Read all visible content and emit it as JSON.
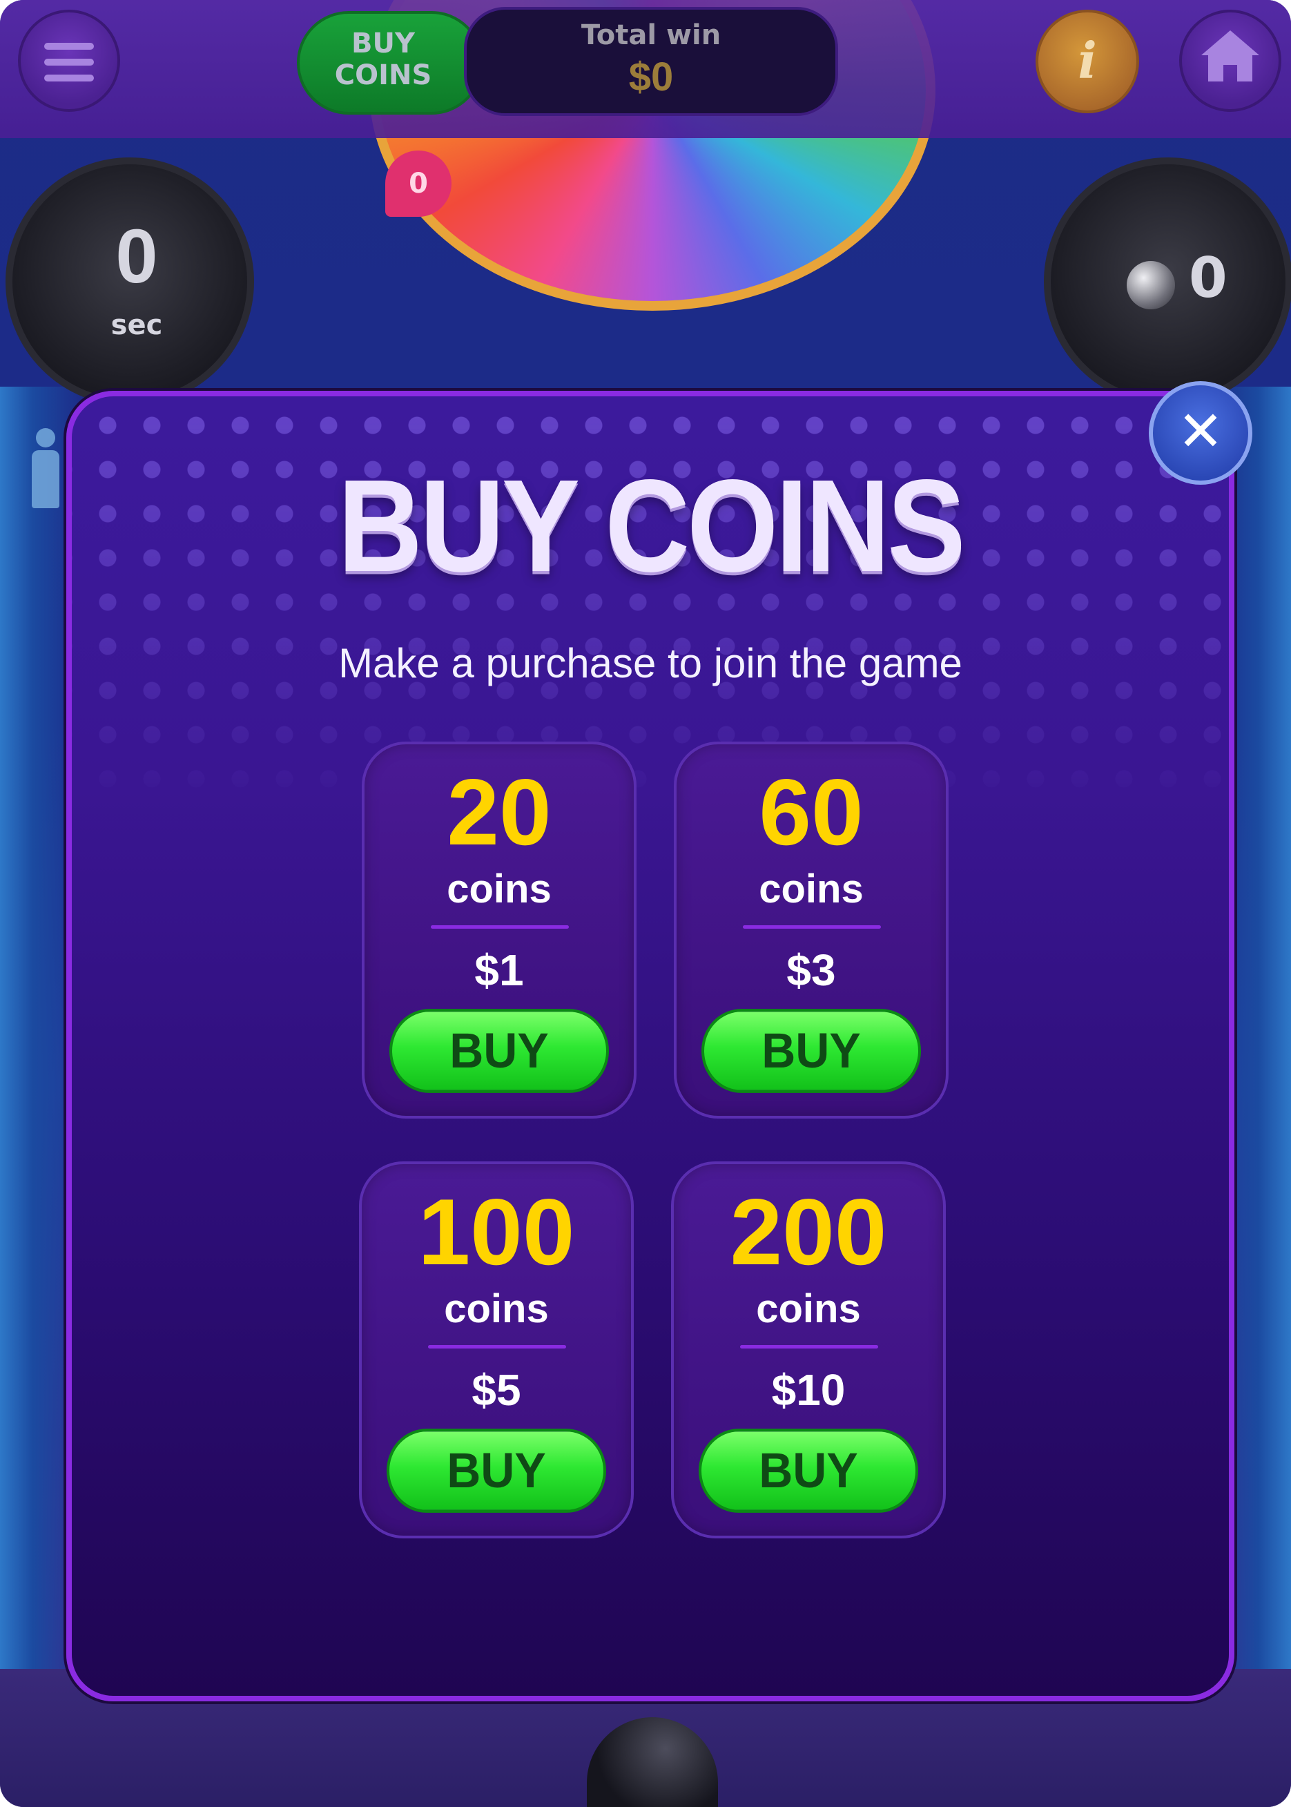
{
  "header": {
    "buy_coins_line1": "BUY",
    "buy_coins_line2": "COINS",
    "total_win_label": "Total win",
    "total_win_value": "$0",
    "info_glyph": "i"
  },
  "timer": {
    "value": "0",
    "unit": "sec"
  },
  "balls": {
    "count": "0"
  },
  "wheel": {
    "badge": "0"
  },
  "modal": {
    "title": "BUY COINS",
    "subtitle": "Make a purchase to join the game",
    "close_glyph": "✕",
    "packs": [
      {
        "amount": "20",
        "unit": "coins",
        "price": "$1",
        "buy_label": "BUY"
      },
      {
        "amount": "60",
        "unit": "coins",
        "price": "$3",
        "buy_label": "BUY"
      },
      {
        "amount": "100",
        "unit": "coins",
        "price": "$5",
        "buy_label": "BUY"
      },
      {
        "amount": "200",
        "unit": "coins",
        "price": "$10",
        "buy_label": "BUY"
      }
    ]
  },
  "colors": {
    "accent_purple": "#8a2be2",
    "coin_yellow": "#ffd400",
    "buy_green": "#2ee832",
    "close_blue": "#2a47b5"
  },
  "icons": [
    "hamburger-menu-icon",
    "info-icon",
    "home-icon",
    "close-icon",
    "ball-icon",
    "players-icon"
  ]
}
